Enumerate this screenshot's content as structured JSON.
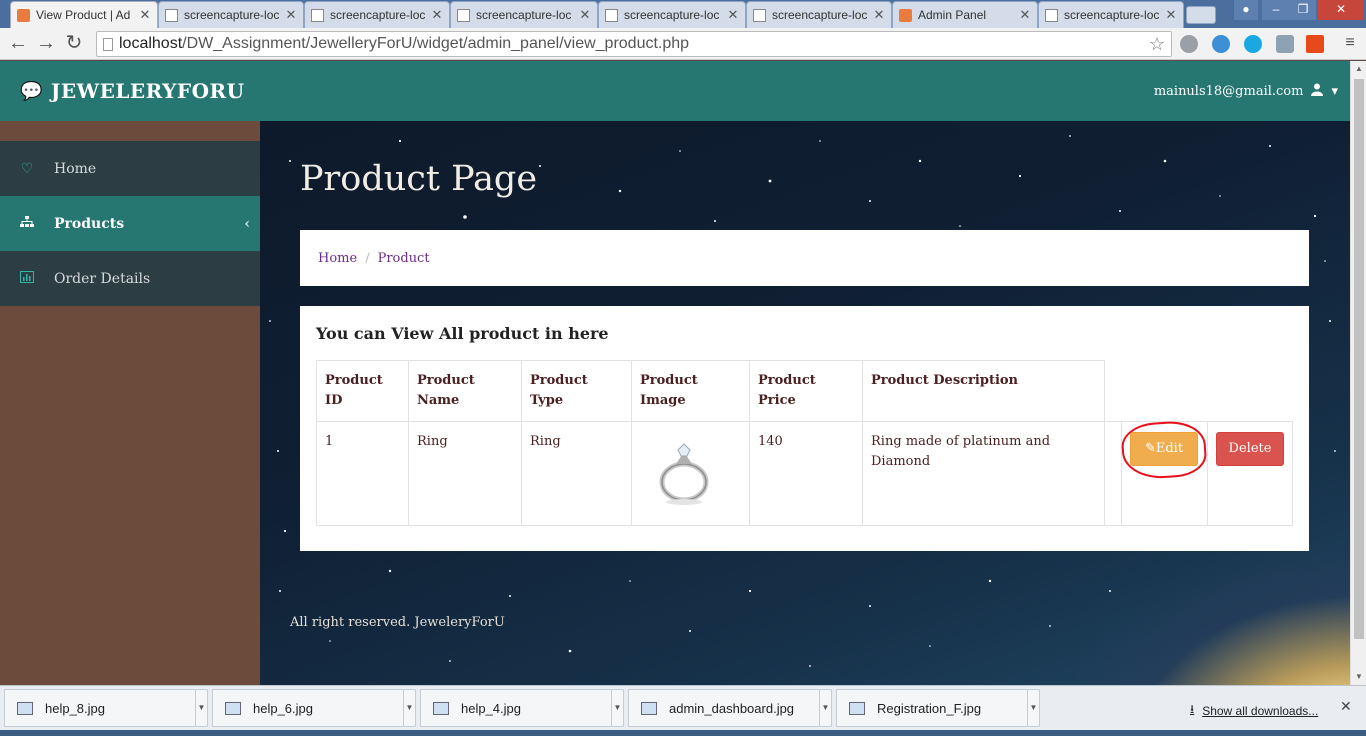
{
  "browser": {
    "tabs": [
      {
        "label": "View Product | Ad",
        "icon": "xampp-icon",
        "active": true
      },
      {
        "label": "screencapture-loc",
        "icon": "doc-icon"
      },
      {
        "label": "screencapture-loc",
        "icon": "doc-icon"
      },
      {
        "label": "screencapture-loc",
        "icon": "doc-icon"
      },
      {
        "label": "screencapture-loc",
        "icon": "doc-icon"
      },
      {
        "label": "screencapture-loc",
        "icon": "doc-icon"
      },
      {
        "label": "Admin Panel",
        "icon": "xampp-icon"
      },
      {
        "label": "screencapture-loc",
        "icon": "doc-icon"
      }
    ],
    "url_host": "localhost",
    "url_path": "/DW_Assignment/JewelleryForU/widget/admin_panel/view_product.php"
  },
  "header": {
    "brand": "JEWELERYFORU",
    "user_email": "mainuls18@gmail.com"
  },
  "sidebar": {
    "items": [
      {
        "label": "Home",
        "icon": "heart-icon"
      },
      {
        "label": "Products",
        "icon": "sitemap-icon",
        "active": true
      },
      {
        "label": "Order Details",
        "icon": "bar-chart-icon"
      }
    ]
  },
  "main": {
    "page_title": "Product Page",
    "breadcrumb": [
      "Home",
      "Product"
    ],
    "card_title": "You can View All product in here",
    "table": {
      "headers": [
        "Product ID",
        "Product Name",
        "Product Type",
        "Product Image",
        "Product Price",
        "Product Description"
      ],
      "rows": [
        {
          "id": "1",
          "name": "Ring",
          "type": "Ring",
          "image": "ring-image",
          "price": "140",
          "description": "Ring made of platinum and Diamond"
        }
      ],
      "edit_label": "Edit",
      "delete_label": "Delete"
    },
    "footer": "All right reserved. JeweleryForU"
  },
  "downloads": {
    "items": [
      "help_8.jpg",
      "help_6.jpg",
      "help_4.jpg",
      "admin_dashboard.jpg",
      "Registration_F.jpg"
    ],
    "show_all": "Show all downloads..."
  },
  "colors": {
    "header_teal": "#267672",
    "sidebar_brown": "#6c4a3c",
    "sidebar_item": "#2c3d44",
    "edit_orange": "#f0ad4e",
    "delete_red": "#d9534f",
    "annotation_red": "#e8101a"
  }
}
